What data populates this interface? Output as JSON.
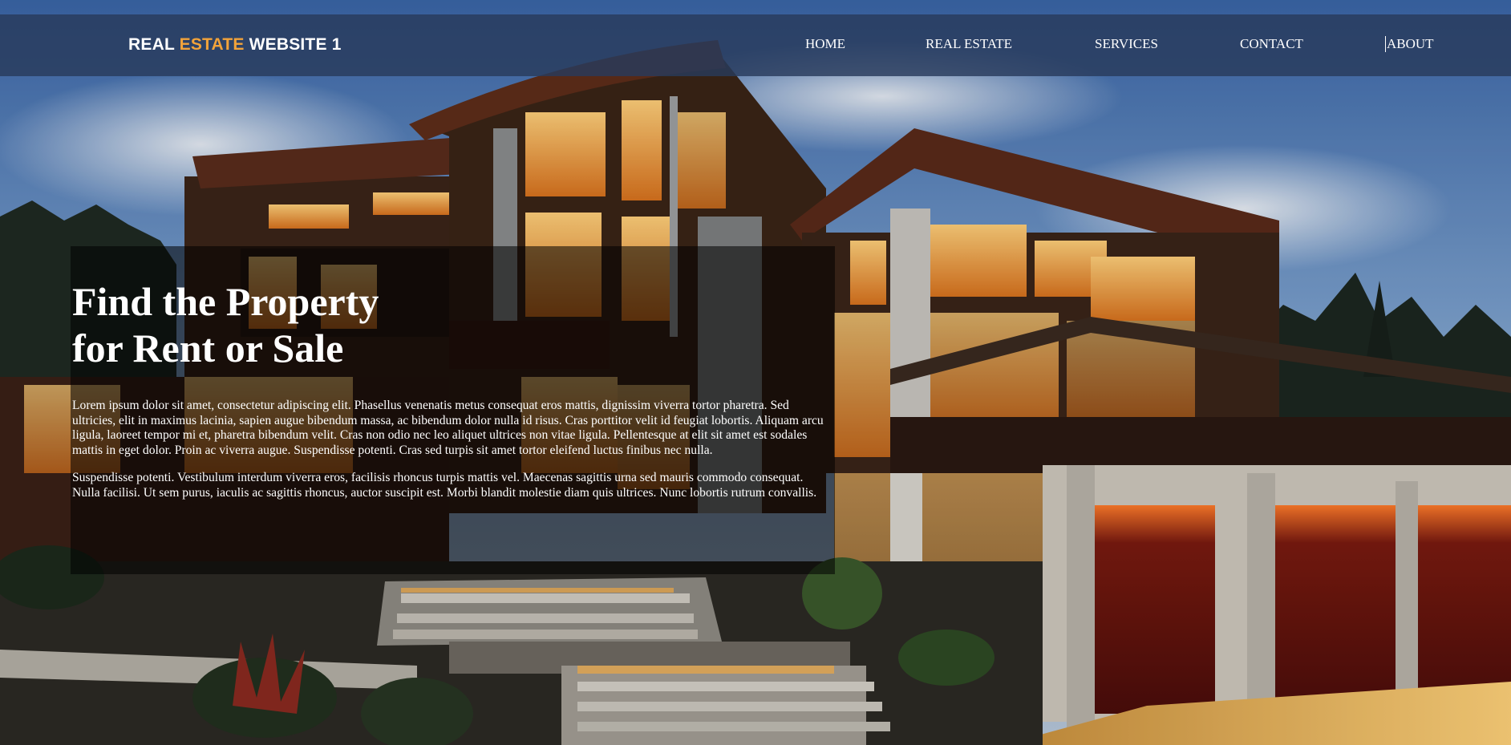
{
  "brand": {
    "part1": "REAL ",
    "part2": "ESTATE",
    "part3": " WEBSITE 1",
    "accent_color": "#f2a33a"
  },
  "nav": {
    "items": [
      {
        "label": "HOME"
      },
      {
        "label": "REAL ESTATE"
      },
      {
        "label": "SERVICES"
      },
      {
        "label": "CONTACT"
      },
      {
        "label": "ABOUT"
      }
    ]
  },
  "hero": {
    "title_line1": "Find the Property",
    "title_line2": "for Rent or Sale",
    "paragraph1": "Lorem ipsum dolor sit amet, consectetur adipiscing elit. Phasellus venenatis metus consequat eros mattis, dignissim viverra tortor pharetra. Sed ultricies, elit in maximus lacinia, sapien augue bibendum massa, ac bibendum dolor nulla id risus. Cras porttitor velit id feugiat lobortis. Aliquam arcu ligula, laoreet tempor mi et, pharetra bibendum velit. Cras non odio nec leo aliquet ultrices non vitae ligula. Pellentesque at elit sit amet est sodales mattis in eget dolor. Proin ac viverra augue. Suspendisse potenti. Cras sed turpis sit amet tortor eleifend luctus finibus nec nulla.",
    "paragraph2": "Suspendisse potenti. Vestibulum interdum viverra eros, facilisis rhoncus turpis mattis vel. Maecenas sagittis urna sed mauris commodo consequat. Nulla facilisi. Ut sem purus, iaculis ac sagittis rhoncus, auctor suscipit est. Morbi blandit molestie diam quis ultrices. Nunc lobortis rutrum convallis."
  },
  "colors": {
    "navbar_bg": "#283a5c",
    "text": "#ffffff",
    "sky_top": "#3f6fb3",
    "window_glow": "#f0a040"
  }
}
